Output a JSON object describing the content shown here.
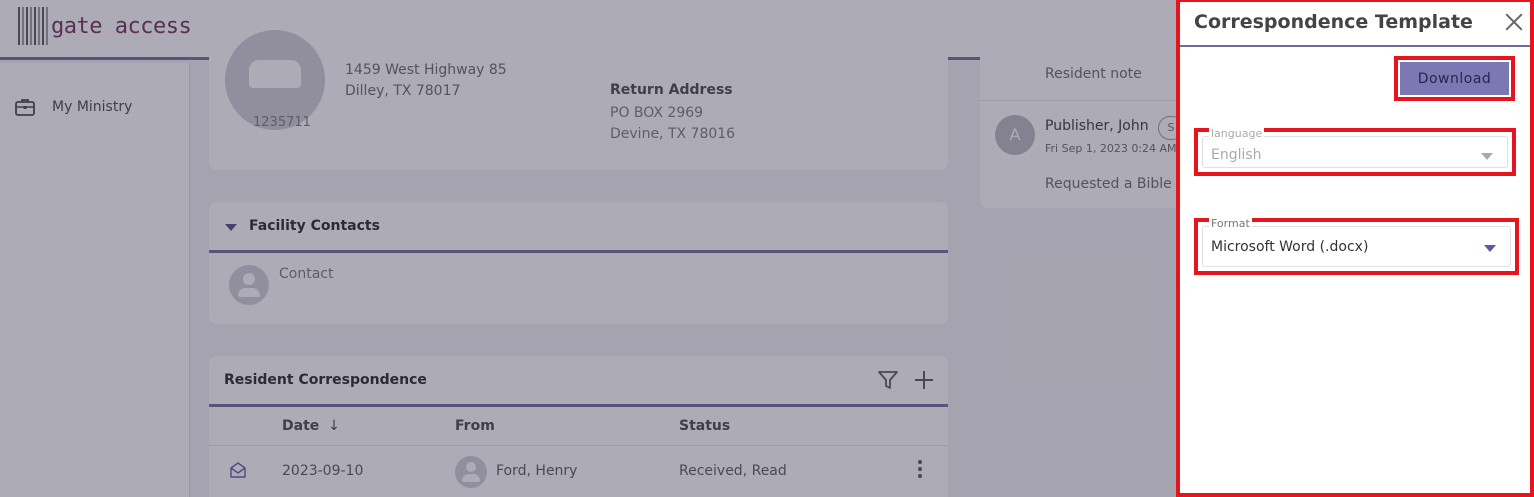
{
  "app": {
    "logo_text": "gate access",
    "sidebar": {
      "items": [
        {
          "label": "My Ministry",
          "icon": "briefcase-icon"
        }
      ]
    }
  },
  "resident": {
    "id": "1235711",
    "address_lines": [
      "1459 West Highway 85",
      "Dilley, TX 78017"
    ],
    "return_address": {
      "title": "Return Address",
      "lines": [
        "PO BOX 2969",
        "Devine, TX 78016"
      ]
    }
  },
  "facility_contacts": {
    "title": "Facility Contacts",
    "contact_label": "Contact"
  },
  "correspondence": {
    "title": "Resident Correspondence",
    "columns": {
      "date": "Date",
      "from": "From",
      "status": "Status"
    },
    "sort_indicator": "↓",
    "rows": [
      {
        "date": "2023-09-10",
        "from": "Ford, Henry",
        "status": "Received, Read"
      }
    ]
  },
  "notes": {
    "resident_note_label": "Resident note",
    "entries": [
      {
        "avatar_letter": "A",
        "author": "Publisher, John",
        "badge": "S",
        "date": "Fri Sep 1, 2023 0:24 AM",
        "message": "Requested a Bible"
      }
    ]
  },
  "panel": {
    "title": "Correspondence Template",
    "download_label": "Download",
    "language": {
      "label": "language",
      "value": "English"
    },
    "format": {
      "label": "Format",
      "value": "Microsoft Word (.docx)"
    }
  },
  "colors": {
    "accent": "#6d6a9e",
    "download_button": "#7b78b4",
    "highlight_border": "#e6141d",
    "logo_text": "#6b2b55"
  }
}
